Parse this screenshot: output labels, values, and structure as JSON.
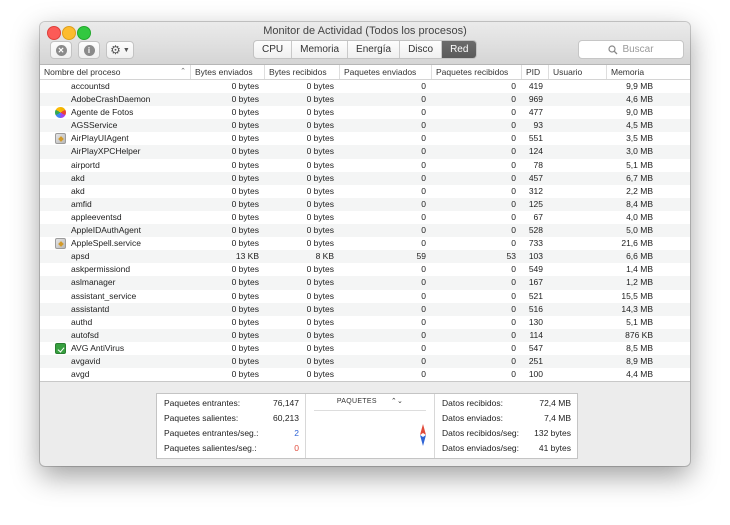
{
  "window": {
    "title": "Monitor de Actividad (Todos los procesos)"
  },
  "toolbar": {
    "tabs": [
      {
        "label": "CPU",
        "active": false
      },
      {
        "label": "Memoria",
        "active": false
      },
      {
        "label": "Energía",
        "active": false
      },
      {
        "label": "Disco",
        "active": false
      },
      {
        "label": "Red",
        "active": true
      }
    ],
    "search_placeholder": "Buscar"
  },
  "table": {
    "columns": [
      "Nombre del proceso",
      "Bytes enviados",
      "Bytes recibidos",
      "Paquetes enviados",
      "Paquetes recibidos",
      "PID",
      "Usuario",
      "Memoria"
    ],
    "rows": [
      {
        "name": "accountsd",
        "icon": "",
        "sent": "0 bytes",
        "recv": "0 bytes",
        "psent": "0",
        "precv": "0",
        "pid": "419",
        "user": "",
        "mem": "9,9 MB"
      },
      {
        "name": "AdobeCrashDaemon",
        "icon": "",
        "sent": "0 bytes",
        "recv": "0 bytes",
        "psent": "0",
        "precv": "0",
        "pid": "969",
        "user": "",
        "mem": "4,6 MB"
      },
      {
        "name": "Agente de Fotos",
        "icon": "photos-icon",
        "sent": "0 bytes",
        "recv": "0 bytes",
        "psent": "0",
        "precv": "0",
        "pid": "477",
        "user": "",
        "mem": "9,0 MB"
      },
      {
        "name": "AGSService",
        "icon": "",
        "sent": "0 bytes",
        "recv": "0 bytes",
        "psent": "0",
        "precv": "0",
        "pid": "93",
        "user": "",
        "mem": "4,5 MB"
      },
      {
        "name": "AirPlayUIAgent",
        "icon": "app-icon",
        "sent": "0 bytes",
        "recv": "0 bytes",
        "psent": "0",
        "precv": "0",
        "pid": "551",
        "user": "",
        "mem": "3,5 MB"
      },
      {
        "name": "AirPlayXPCHelper",
        "icon": "",
        "sent": "0 bytes",
        "recv": "0 bytes",
        "psent": "0",
        "precv": "0",
        "pid": "124",
        "user": "",
        "mem": "3,0 MB"
      },
      {
        "name": "airportd",
        "icon": "",
        "sent": "0 bytes",
        "recv": "0 bytes",
        "psent": "0",
        "precv": "0",
        "pid": "78",
        "user": "",
        "mem": "5,1 MB"
      },
      {
        "name": "akd",
        "icon": "",
        "sent": "0 bytes",
        "recv": "0 bytes",
        "psent": "0",
        "precv": "0",
        "pid": "457",
        "user": "",
        "mem": "6,7 MB"
      },
      {
        "name": "akd",
        "icon": "",
        "sent": "0 bytes",
        "recv": "0 bytes",
        "psent": "0",
        "precv": "0",
        "pid": "312",
        "user": "",
        "mem": "2,2 MB"
      },
      {
        "name": "amfid",
        "icon": "",
        "sent": "0 bytes",
        "recv": "0 bytes",
        "psent": "0",
        "precv": "0",
        "pid": "125",
        "user": "",
        "mem": "8,4 MB"
      },
      {
        "name": "appleeventsd",
        "icon": "",
        "sent": "0 bytes",
        "recv": "0 bytes",
        "psent": "0",
        "precv": "0",
        "pid": "67",
        "user": "",
        "mem": "4,0 MB"
      },
      {
        "name": "AppleIDAuthAgent",
        "icon": "",
        "sent": "0 bytes",
        "recv": "0 bytes",
        "psent": "0",
        "precv": "0",
        "pid": "528",
        "user": "",
        "mem": "5,0 MB"
      },
      {
        "name": "AppleSpell.service",
        "icon": "app-icon",
        "sent": "0 bytes",
        "recv": "0 bytes",
        "psent": "0",
        "precv": "0",
        "pid": "733",
        "user": "",
        "mem": "21,6 MB"
      },
      {
        "name": "apsd",
        "icon": "",
        "sent": "13 KB",
        "recv": "8 KB",
        "psent": "59",
        "precv": "53",
        "pid": "103",
        "user": "",
        "mem": "6,6 MB"
      },
      {
        "name": "askpermissiond",
        "icon": "",
        "sent": "0 bytes",
        "recv": "0 bytes",
        "psent": "0",
        "precv": "0",
        "pid": "549",
        "user": "",
        "mem": "1,4 MB"
      },
      {
        "name": "aslmanager",
        "icon": "",
        "sent": "0 bytes",
        "recv": "0 bytes",
        "psent": "0",
        "precv": "0",
        "pid": "167",
        "user": "",
        "mem": "1,2 MB"
      },
      {
        "name": "assistant_service",
        "icon": "",
        "sent": "0 bytes",
        "recv": "0 bytes",
        "psent": "0",
        "precv": "0",
        "pid": "521",
        "user": "",
        "mem": "15,5 MB"
      },
      {
        "name": "assistantd",
        "icon": "",
        "sent": "0 bytes",
        "recv": "0 bytes",
        "psent": "0",
        "precv": "0",
        "pid": "516",
        "user": "",
        "mem": "14,3 MB"
      },
      {
        "name": "authd",
        "icon": "",
        "sent": "0 bytes",
        "recv": "0 bytes",
        "psent": "0",
        "precv": "0",
        "pid": "130",
        "user": "",
        "mem": "5,1 MB"
      },
      {
        "name": "autofsd",
        "icon": "",
        "sent": "0 bytes",
        "recv": "0 bytes",
        "psent": "0",
        "precv": "0",
        "pid": "114",
        "user": "",
        "mem": "876 KB"
      },
      {
        "name": "AVG AntiVirus",
        "icon": "avg-icon",
        "sent": "0 bytes",
        "recv": "0 bytes",
        "psent": "0",
        "precv": "0",
        "pid": "547",
        "user": "",
        "mem": "8,5 MB"
      },
      {
        "name": "avgavid",
        "icon": "",
        "sent": "0 bytes",
        "recv": "0 bytes",
        "psent": "0",
        "precv": "0",
        "pid": "251",
        "user": "",
        "mem": "8,9 MB"
      },
      {
        "name": "avgd",
        "icon": "",
        "sent": "0 bytes",
        "recv": "0 bytes",
        "psent": "0",
        "precv": "0",
        "pid": "100",
        "user": "",
        "mem": "4,4 MB"
      }
    ]
  },
  "stats": {
    "left": [
      {
        "label": "Paquetes entrantes:",
        "value": "76,147",
        "color": ""
      },
      {
        "label": "Paquetes salientes:",
        "value": "60,213",
        "color": ""
      },
      {
        "label": "Paquetes entrantes/seg.:",
        "value": "2",
        "color": "#2f64d6"
      },
      {
        "label": "Paquetes salientes/seg.:",
        "value": "0",
        "color": "#e14b3b"
      }
    ],
    "graph_selector": "PAQUETES",
    "right": [
      {
        "label": "Datos recibidos:",
        "value": "72,4 MB"
      },
      {
        "label": "Datos enviados:",
        "value": "7,4 MB"
      },
      {
        "label": "Datos recibidos/seg:",
        "value": "132 bytes"
      },
      {
        "label": "Datos enviados/seg:",
        "value": "41 bytes"
      }
    ]
  }
}
